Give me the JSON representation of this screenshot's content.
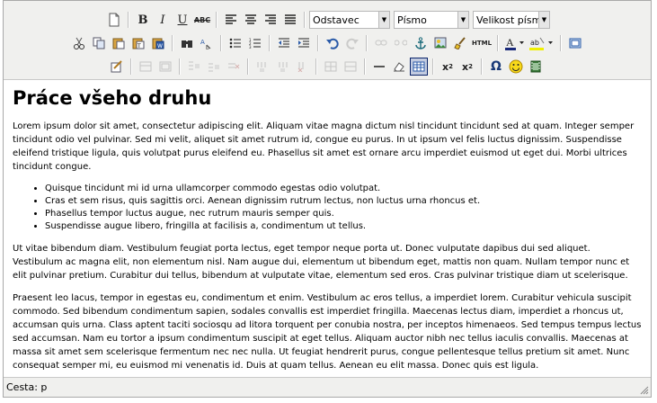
{
  "toolbar": {
    "format_select": "Odstavec",
    "font_select": "Písmo",
    "size_select": "Velikost písma",
    "html_label": "HTML",
    "omega": "Ω"
  },
  "document": {
    "heading": "Práce všeho druhu",
    "paragraph1": "Lorem ipsum dolor sit amet, consectetur adipiscing elit. Aliquam vitae magna dictum nisl tincidunt tincidunt sed at quam. Integer semper tincidunt odio vel pulvinar. Sed mi velit, aliquet sit amet rutrum id, congue eu purus. In ut ipsum vel felis luctus dignissim. Suspendisse eleifend tristique ligula, quis volutpat purus eleifend eu. Phasellus sit amet est ornare arcu imperdiet euismod ut eget dui. Morbi ultrices tincidunt congue.",
    "list": [
      "Quisque tincidunt mi id urna ullamcorper commodo egestas odio volutpat.",
      "Cras et sem risus, quis sagittis orci. Aenean dignissim rutrum lectus, non luctus urna rhoncus et.",
      "Phasellus tempor luctus augue, nec rutrum mauris semper quis.",
      "Suspendisse augue libero, fringilla at facilisis a, condimentum ut tellus."
    ],
    "paragraph2": "Ut vitae bibendum diam. Vestibulum feugiat porta lectus, eget tempor neque porta ut. Donec vulputate dapibus dui sed aliquet. Vestibulum ac magna elit, non elementum nisl. Nam augue dui, elementum ut bibendum eget, mattis non quam. Nullam tempor nunc et elit pulvinar pretium. Curabitur dui tellus, bibendum at vulputate vitae, elementum sed eros. Cras pulvinar tristique diam ut scelerisque.",
    "paragraph3": "Praesent leo lacus, tempor in egestas eu, condimentum et enim. Vestibulum ac eros tellus, a imperdiet lorem. Curabitur vehicula suscipit commodo. Sed bibendum condimentum sapien, sodales convallis est imperdiet fringilla. Maecenas lectus diam, imperdiet a rhoncus ut, accumsan quis urna. Class aptent taciti sociosqu ad litora torquent per conubia nostra, per inceptos himenaeos. Sed tempus tempus lectus sed accumsan. Nam eu tortor a ipsum condimentum suscipit at eget tellus. Aliquam auctor nibh nec tellus iaculis convallis. Maecenas at massa sit amet sem scelerisque fermentum nec nec nulla. Ut feugiat hendrerit purus, congue pellentesque tellus pretium sit amet. Nunc consequat semper mi, eu euismod mi venenatis id. Duis at quam tellus. Aenean eu elit massa. Donec quis est ligula."
  },
  "status": {
    "path": "Cesta: p"
  },
  "colors": {
    "accent": "#0a246a",
    "toolbar_bg": "#f0f0ee",
    "border": "#a9a9a9"
  }
}
